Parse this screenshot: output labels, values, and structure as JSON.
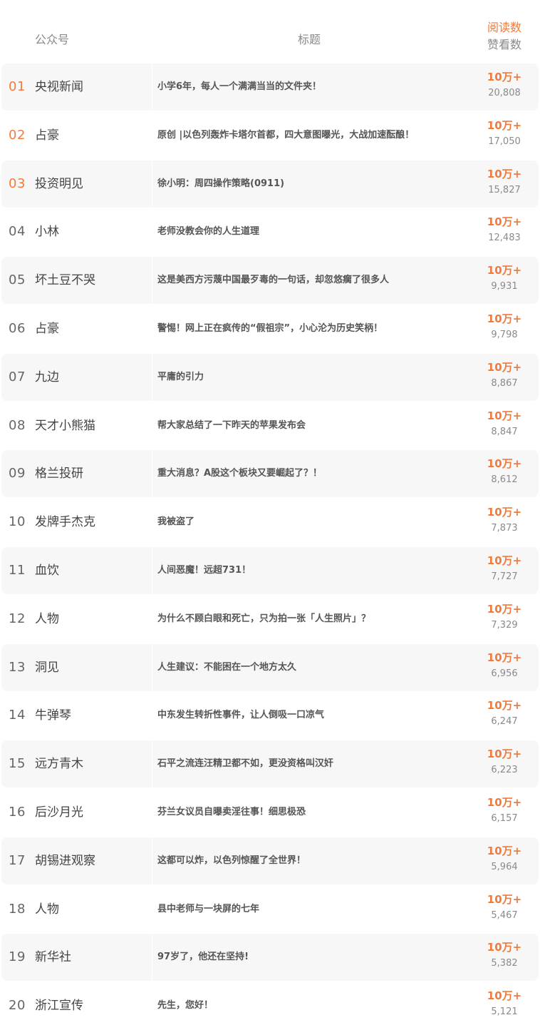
{
  "header": {
    "account_label": "公众号",
    "title_label": "标题",
    "read_label": "阅读数",
    "like_label": "赞看数"
  },
  "rows": [
    {
      "rank": "01",
      "account": "央视新闻",
      "title": "小学6年，每人一个满满当当的文件夹！",
      "reads": "10万+",
      "likes": "20,808"
    },
    {
      "rank": "02",
      "account": "占豪",
      "title": "原创 |以色列轰炸卡塔尔首都，四大意图曝光，大战加速酝酿！",
      "reads": "10万+",
      "likes": "17,050"
    },
    {
      "rank": "03",
      "account": "投资明见",
      "title": "徐小明：周四操作策略(0911)",
      "reads": "10万+",
      "likes": "15,827"
    },
    {
      "rank": "04",
      "account": "小林",
      "title": "老师没教会你的人生道理",
      "reads": "10万+",
      "likes": "12,483"
    },
    {
      "rank": "05",
      "account": "坏土豆不哭",
      "title": "这是美西方污蔑中国最歹毒的一句话，却忽悠瘸了很多人",
      "reads": "10万+",
      "likes": "9,931"
    },
    {
      "rank": "06",
      "account": "占豪",
      "title": "警惕！网上正在疯传的“假祖宗”，小心沦为历史笑柄！",
      "reads": "10万+",
      "likes": "9,798"
    },
    {
      "rank": "07",
      "account": "九边",
      "title": "平庸的引力",
      "reads": "10万+",
      "likes": "8,867"
    },
    {
      "rank": "08",
      "account": "天才小熊猫",
      "title": "帮大家总结了一下昨天的苹果发布会",
      "reads": "10万+",
      "likes": "8,847"
    },
    {
      "rank": "09",
      "account": "格兰投研",
      "title": "重大消息？A股这个板块又要崛起了？！",
      "reads": "10万+",
      "likes": "8,612"
    },
    {
      "rank": "10",
      "account": "发牌手杰克",
      "title": "我被盗了",
      "reads": "10万+",
      "likes": "7,873"
    },
    {
      "rank": "11",
      "account": "血饮",
      "title": "人间恶魔！远超731！",
      "reads": "10万+",
      "likes": "7,727"
    },
    {
      "rank": "12",
      "account": "人物",
      "title": "为什么不顾白眼和死亡，只为拍一张「人生照片」？",
      "reads": "10万+",
      "likes": "7,329"
    },
    {
      "rank": "13",
      "account": "洞见",
      "title": "人生建议：不能困在一个地方太久",
      "reads": "10万+",
      "likes": "6,956"
    },
    {
      "rank": "14",
      "account": "牛弹琴",
      "title": "中东发生转折性事件，让人倒吸一口凉气",
      "reads": "10万+",
      "likes": "6,247"
    },
    {
      "rank": "15",
      "account": "远方青木",
      "title": "石平之流连汪精卫都不如，更没资格叫汉奸",
      "reads": "10万+",
      "likes": "6,223"
    },
    {
      "rank": "16",
      "account": "后沙月光",
      "title": "芬兰女议员自曝卖淫往事！细思极恐",
      "reads": "10万+",
      "likes": "6,157"
    },
    {
      "rank": "17",
      "account": "胡锡进观察",
      "title": "这都可以炸，以色列惊醒了全世界！",
      "reads": "10万+",
      "likes": "5,964"
    },
    {
      "rank": "18",
      "account": "人物",
      "title": "县中老师与一块屏的七年",
      "reads": "10万+",
      "likes": "5,467"
    },
    {
      "rank": "19",
      "account": "新华社",
      "title": "97岁了，他还在坚持!",
      "reads": "10万+",
      "likes": "5,382"
    },
    {
      "rank": "20",
      "account": "浙江宣传",
      "title": "先生，您好！",
      "reads": "10万+",
      "likes": "5,121"
    }
  ],
  "colors": {
    "accent": "#ef7b3e",
    "muted": "#8a8a8a",
    "stripe": "#f7f7f7"
  }
}
